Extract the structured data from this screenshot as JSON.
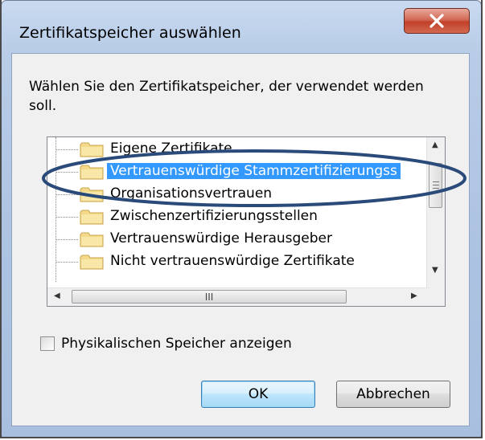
{
  "window": {
    "title": "Zertifikatspeicher auswählen",
    "close_glyph": "x"
  },
  "instruction": "Wählen Sie den Zertifikatspeicher, der verwendet werden soll.",
  "tree": {
    "items": [
      {
        "label": "Eigene Zertifikate",
        "icon": "folder-icon",
        "selected": false
      },
      {
        "label": "Vertrauenswürdige Stammzertifizierungss",
        "icon": "folder-icon",
        "selected": true
      },
      {
        "label": "Organisationsvertrauen",
        "icon": "folder-icon",
        "selected": false
      },
      {
        "label": "Zwischenzertifizierungsstellen",
        "icon": "folder-icon",
        "selected": false
      },
      {
        "label": "Vertrauenswürdige Herausgeber",
        "icon": "folder-icon",
        "selected": false
      },
      {
        "label": "Nicht vertrauenswürdige Zertifikate",
        "icon": "folder-icon",
        "selected": false
      }
    ],
    "hscroll_grip": "III"
  },
  "checkbox": {
    "label": "Physikalischen Speicher anzeigen",
    "checked": false
  },
  "buttons": {
    "ok": "OK",
    "cancel": "Abbrechen"
  },
  "colors": {
    "selection": "#3399ff",
    "annotation": "#2a4a7a",
    "close": "#c2402a"
  }
}
